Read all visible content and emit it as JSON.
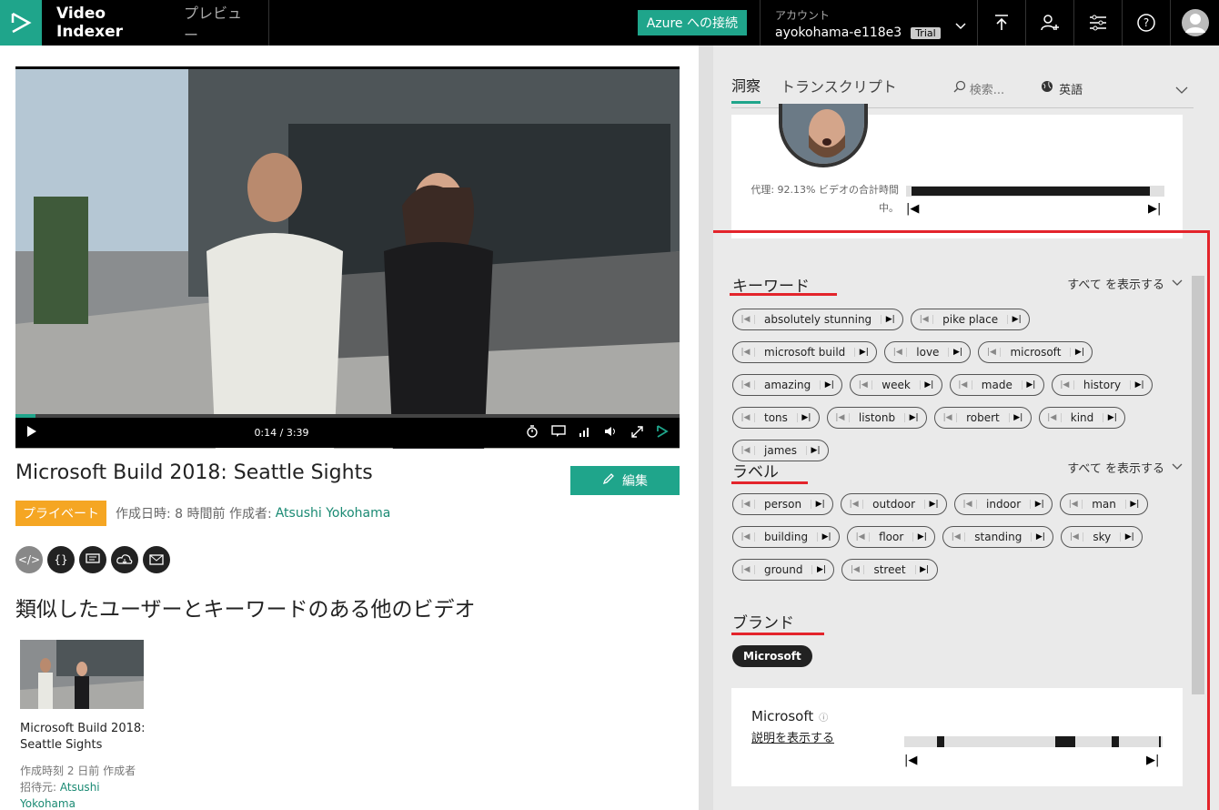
{
  "header": {
    "app_name": "Video Indexer",
    "preview_label": "プレビュー",
    "azure_button": "Azure への接続",
    "account_label": "アカウント",
    "account_name": "ayokohama-e118e3",
    "trial_badge": "Trial"
  },
  "player": {
    "time": "0:14 / 3:39",
    "progress_fraction": 0.064
  },
  "video": {
    "title": "Microsoft Build 2018: Seattle Sights",
    "edit_label": "編集",
    "privacy_badge": "プライベート",
    "created_text": "作成日時: 8 時間前 作成者:",
    "author": "Atsushi Yokohama",
    "action_icons": [
      "embed-icon",
      "json-icon",
      "captions-icon",
      "download-icon",
      "email-icon"
    ]
  },
  "similar": {
    "heading": "類似したユーザーとキーワードのある他のビデオ",
    "items": [
      {
        "title": "Microsoft Build 2018: Seattle Sights",
        "meta": "作成時刻 2 日前 作成者",
        "invited_prefix": "招待元:",
        "invited_by_1": "Atsushi",
        "invited_by_2": "Yokohama"
      }
    ]
  },
  "insights": {
    "tabs": [
      "洞察",
      "トランスクリプト"
    ],
    "search_placeholder": "検索...",
    "language": "英語",
    "person_caption": "代理: 92.13% ビデオの合計時間中。",
    "show_all": "すべて を表示する",
    "keywords_heading": "キーワード",
    "keywords": [
      "absolutely stunning",
      "pike place",
      "microsoft build",
      "love",
      "microsoft",
      "amazing",
      "week",
      "made",
      "history",
      "tons",
      "listonb",
      "robert",
      "kind",
      "james"
    ],
    "labels_heading": "ラベル",
    "labels": [
      "person",
      "outdoor",
      "indoor",
      "man",
      "building",
      "floor",
      "standing",
      "sky",
      "ground",
      "street"
    ],
    "brands_heading": "ブランド",
    "brand_chip": "Microsoft",
    "brand_name": "Microsoft",
    "brand_info": "ⓘ",
    "brand_desc_link": "説明を表示する"
  },
  "colors": {
    "accent": "#1fa58b",
    "highlight": "#e3242b",
    "private": "#f5a623"
  }
}
